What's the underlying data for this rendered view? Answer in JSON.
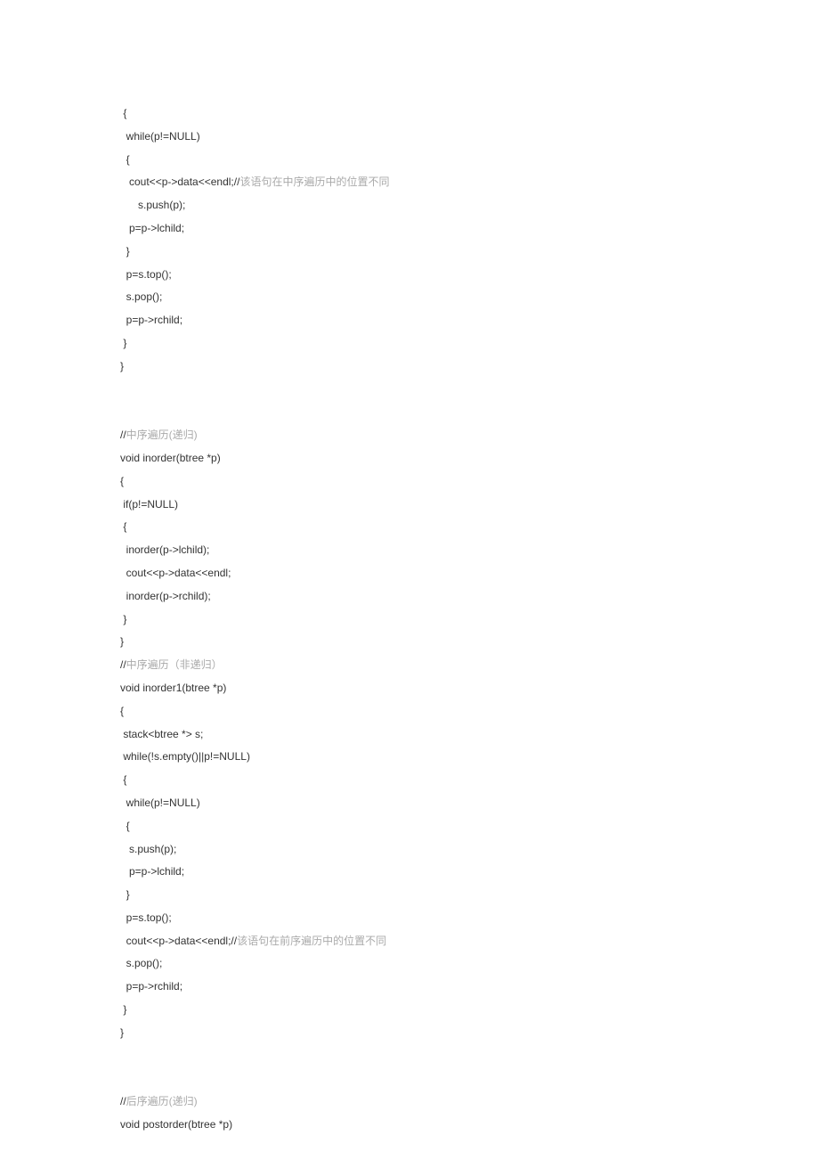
{
  "lines": [
    {
      "segments": [
        {
          "text": " {",
          "cls": "normal"
        }
      ]
    },
    {
      "segments": [
        {
          "text": "  while(p!=NULL)",
          "cls": "normal"
        }
      ]
    },
    {
      "segments": [
        {
          "text": "  {",
          "cls": "normal"
        }
      ]
    },
    {
      "segments": [
        {
          "text": "   cout<<p->data<<endl;//",
          "cls": "normal"
        },
        {
          "text": "该语句在中序遍历中的位置不同",
          "cls": "comment"
        }
      ]
    },
    {
      "segments": [
        {
          "text": "      s.push(p);",
          "cls": "normal"
        }
      ]
    },
    {
      "segments": [
        {
          "text": "   p=p->lchild;",
          "cls": "normal"
        }
      ]
    },
    {
      "segments": [
        {
          "text": "  }",
          "cls": "normal"
        }
      ]
    },
    {
      "segments": [
        {
          "text": "  p=s.top();",
          "cls": "normal"
        }
      ]
    },
    {
      "segments": [
        {
          "text": "  s.pop();",
          "cls": "normal"
        }
      ]
    },
    {
      "segments": [
        {
          "text": "  p=p->rchild;",
          "cls": "normal"
        }
      ]
    },
    {
      "segments": [
        {
          "text": " }",
          "cls": "normal"
        }
      ]
    },
    {
      "segments": [
        {
          "text": "}",
          "cls": "normal"
        }
      ]
    },
    {
      "segments": [
        {
          "text": " ",
          "cls": "normal"
        }
      ]
    },
    {
      "segments": [
        {
          "text": " ",
          "cls": "normal"
        }
      ]
    },
    {
      "segments": [
        {
          "text": "//",
          "cls": "normal"
        },
        {
          "text": "中序遍历(递归)",
          "cls": "comment"
        }
      ]
    },
    {
      "segments": [
        {
          "text": "void inorder(btree *p)",
          "cls": "normal"
        }
      ]
    },
    {
      "segments": [
        {
          "text": "{",
          "cls": "normal"
        }
      ]
    },
    {
      "segments": [
        {
          "text": " if(p!=NULL)",
          "cls": "normal"
        }
      ]
    },
    {
      "segments": [
        {
          "text": " {",
          "cls": "normal"
        }
      ]
    },
    {
      "segments": [
        {
          "text": "  inorder(p->lchild);",
          "cls": "normal"
        }
      ]
    },
    {
      "segments": [
        {
          "text": "  cout<<p->data<<endl;",
          "cls": "normal"
        }
      ]
    },
    {
      "segments": [
        {
          "text": "  inorder(p->rchild);",
          "cls": "normal"
        }
      ]
    },
    {
      "segments": [
        {
          "text": " }",
          "cls": "normal"
        }
      ]
    },
    {
      "segments": [
        {
          "text": "}",
          "cls": "normal"
        }
      ]
    },
    {
      "segments": [
        {
          "text": "//",
          "cls": "normal"
        },
        {
          "text": "中序遍历（非递归）",
          "cls": "comment"
        }
      ]
    },
    {
      "segments": [
        {
          "text": "void inorder1(btree *p)",
          "cls": "normal"
        }
      ]
    },
    {
      "segments": [
        {
          "text": "{",
          "cls": "normal"
        }
      ]
    },
    {
      "segments": [
        {
          "text": " stack<btree *> s;",
          "cls": "normal"
        }
      ]
    },
    {
      "segments": [
        {
          "text": " while(!s.empty()||p!=NULL)",
          "cls": "normal"
        }
      ]
    },
    {
      "segments": [
        {
          "text": " {",
          "cls": "normal"
        }
      ]
    },
    {
      "segments": [
        {
          "text": "  while(p!=NULL)",
          "cls": "normal"
        }
      ]
    },
    {
      "segments": [
        {
          "text": "  {",
          "cls": "normal"
        }
      ]
    },
    {
      "segments": [
        {
          "text": "   s.push(p);",
          "cls": "normal"
        }
      ]
    },
    {
      "segments": [
        {
          "text": "   p=p->lchild;",
          "cls": "normal"
        }
      ]
    },
    {
      "segments": [
        {
          "text": "  }",
          "cls": "normal"
        }
      ]
    },
    {
      "segments": [
        {
          "text": "  p=s.top();",
          "cls": "normal"
        }
      ]
    },
    {
      "segments": [
        {
          "text": "  cout<<p->data<<endl;//",
          "cls": "normal"
        },
        {
          "text": "该语句在前序遍历中的位置不同",
          "cls": "comment"
        }
      ]
    },
    {
      "segments": [
        {
          "text": "  s.pop();",
          "cls": "normal"
        }
      ]
    },
    {
      "segments": [
        {
          "text": "  p=p->rchild;",
          "cls": "normal"
        }
      ]
    },
    {
      "segments": [
        {
          "text": " }",
          "cls": "normal"
        }
      ]
    },
    {
      "segments": [
        {
          "text": "}",
          "cls": "normal"
        }
      ]
    },
    {
      "segments": [
        {
          "text": " ",
          "cls": "normal"
        }
      ]
    },
    {
      "segments": [
        {
          "text": " ",
          "cls": "normal"
        }
      ]
    },
    {
      "segments": [
        {
          "text": "//",
          "cls": "normal"
        },
        {
          "text": "后序遍历(递归)",
          "cls": "comment"
        }
      ]
    },
    {
      "segments": [
        {
          "text": "void postorder(btree *p)",
          "cls": "normal"
        }
      ]
    }
  ]
}
